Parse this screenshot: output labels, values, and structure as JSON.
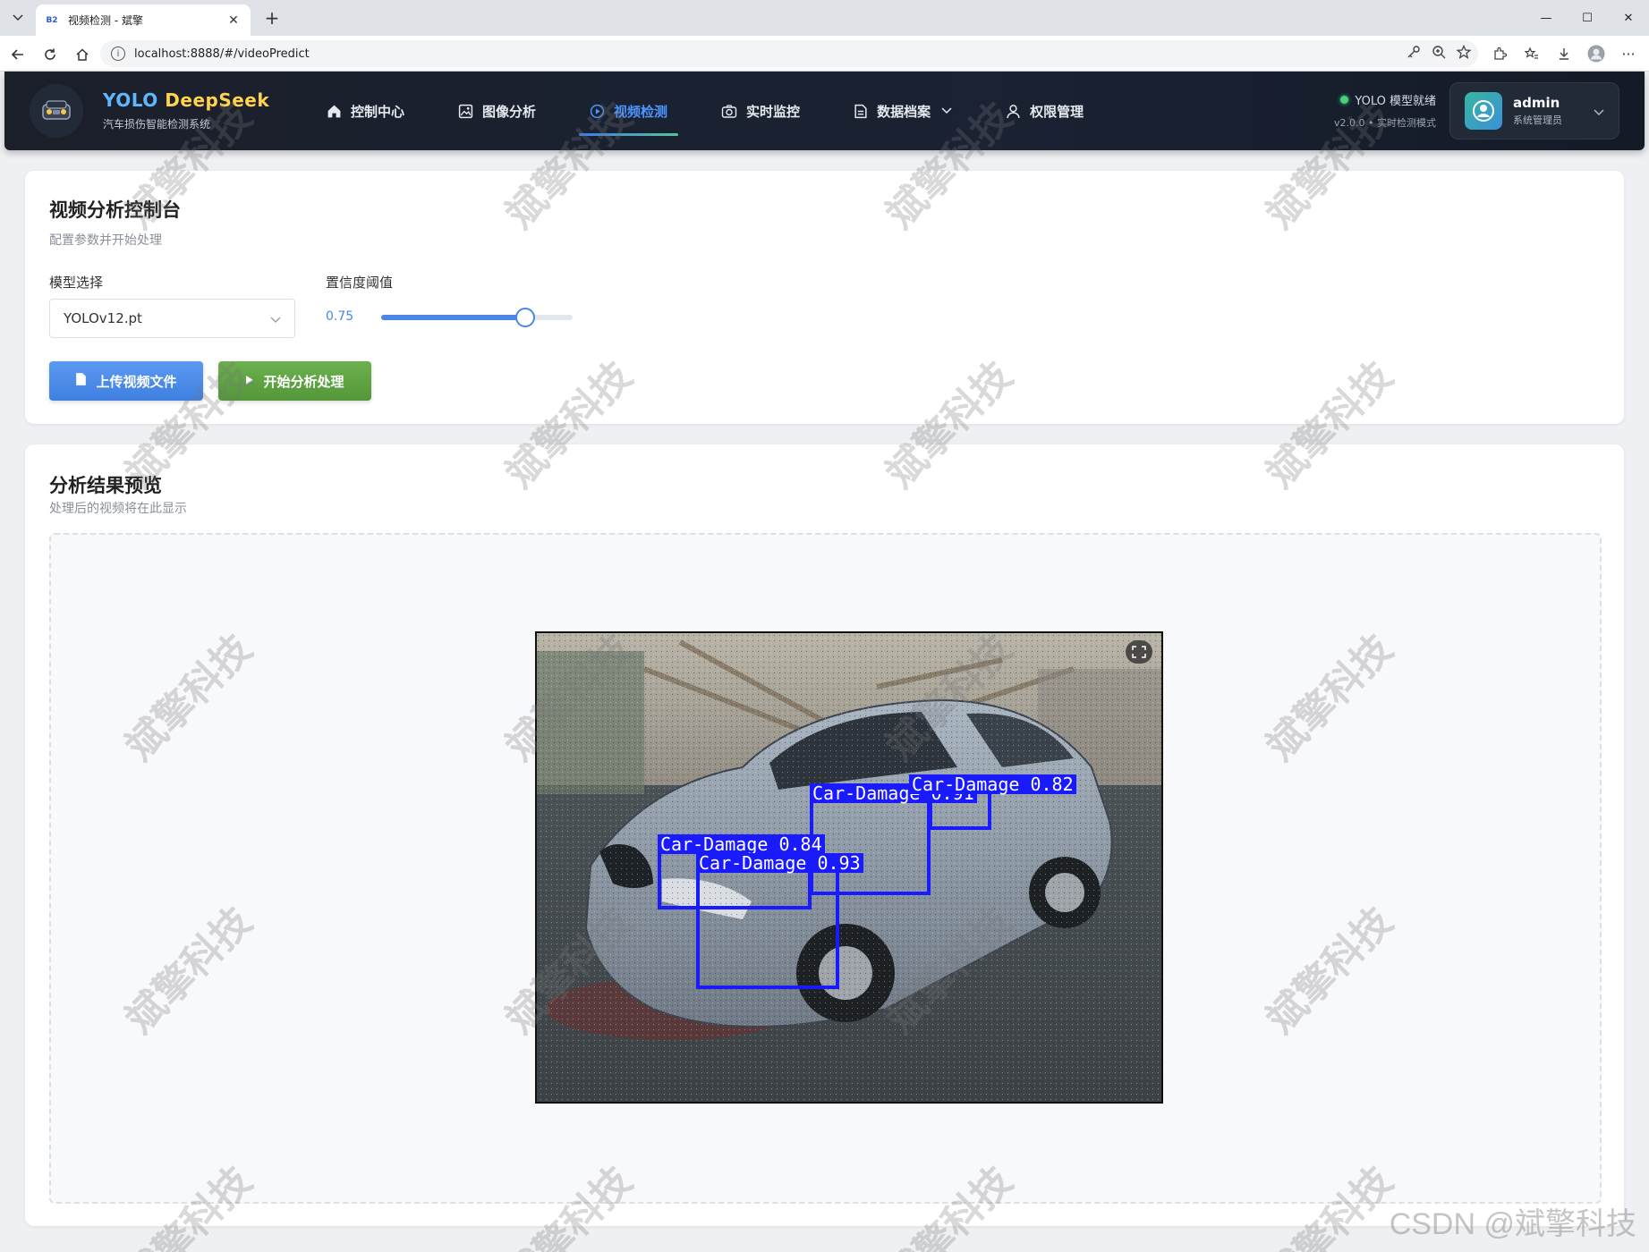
{
  "browser": {
    "tab_title": "视频检测 - 斌擎",
    "tab_favicon": "B2",
    "url": "localhost:8888/#/videoPredict"
  },
  "header": {
    "brand_part1": "YOLO",
    "brand_part2": "DeepSeek",
    "brand_sub": "汽车损伤智能检测系统",
    "nav": [
      {
        "label": "控制中心",
        "icon": "home-icon"
      },
      {
        "label": "图像分析",
        "icon": "image-icon"
      },
      {
        "label": "视频检测",
        "icon": "play-circle-icon"
      },
      {
        "label": "实时监控",
        "icon": "camera-icon"
      },
      {
        "label": "数据档案",
        "icon": "document-icon"
      },
      {
        "label": "权限管理",
        "icon": "user-icon"
      }
    ],
    "status": "YOLO 模型就绪",
    "version": "v2.0.0 • 实时检测模式",
    "user_name": "admin",
    "user_role": "系统管理员"
  },
  "control": {
    "title": "视频分析控制台",
    "subtitle": "配置参数并开始处理",
    "model_label": "模型选择",
    "model_value": "YOLOv12.pt",
    "conf_label": "置信度阈值",
    "conf_value": "0.75",
    "conf_fraction": 0.75,
    "upload_label": "上传视频文件",
    "start_label": "开始分析处理"
  },
  "preview": {
    "title": "分析结果预览",
    "subtitle": "处理后的视频将在此显示",
    "detections": [
      {
        "label": "Car-Damage 0.91"
      },
      {
        "label": "Car-Damage 0.82"
      },
      {
        "label": "Car-Damage 0.84"
      },
      {
        "label": "Car-Damage 0.93"
      }
    ]
  },
  "watermark": {
    "text": "斌擎科技",
    "credit": "CSDN @斌擎科技"
  },
  "colors": {
    "accent": "#4b86e8",
    "detection": "#1a1aff",
    "start_button": "#5ea444",
    "status_ok": "#44d27a"
  }
}
